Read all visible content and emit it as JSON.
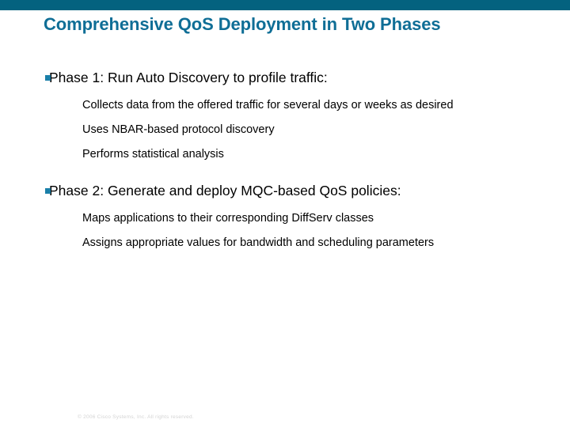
{
  "theme": {
    "top_bar_color": "#04627f",
    "title_color": "#0f6e96",
    "bullet_color": "#1a7fa8",
    "body_text_color": "#000000",
    "footer_color": "#d4d4d4",
    "background_color": "#ffffff"
  },
  "slide": {
    "title": "Comprehensive QoS Deployment in Two Phases",
    "sections": [
      {
        "heading": "Phase 1: Run Auto Discovery to profile traffic:",
        "items": [
          "Collects data from the offered traffic for several days or weeks as desired",
          "Uses NBAR-based protocol discovery",
          "Performs statistical analysis"
        ]
      },
      {
        "heading": "Phase 2: Generate and deploy MQC-based QoS policies:",
        "items": [
          "Maps applications to their corresponding DiffServ classes",
          "Assigns appropriate values for bandwidth and scheduling parameters"
        ]
      }
    ]
  },
  "footer": {
    "copyright": "© 2006 Cisco Systems, Inc. All rights reserved."
  }
}
